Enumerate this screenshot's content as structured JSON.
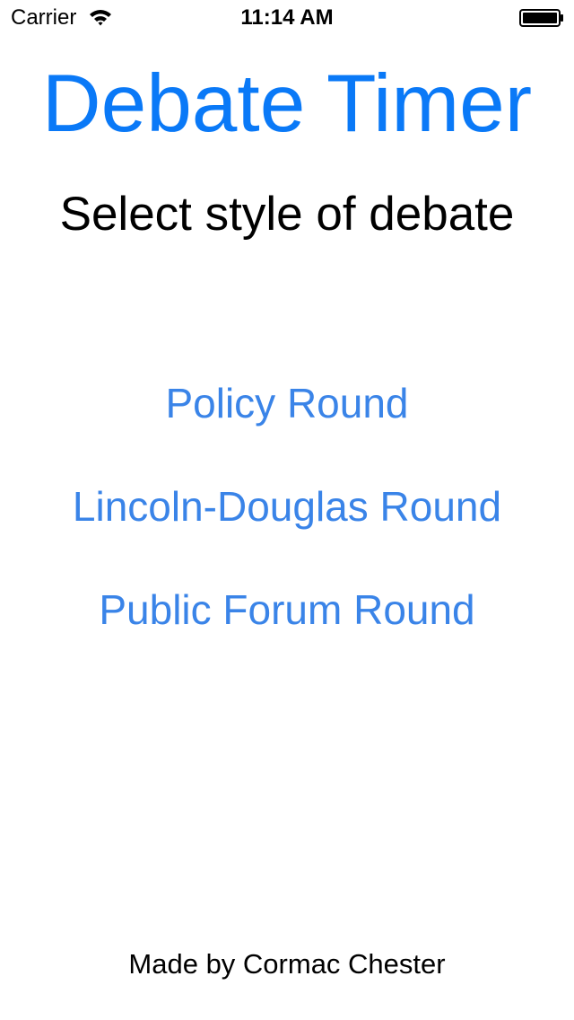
{
  "status_bar": {
    "carrier": "Carrier",
    "time": "11:14 AM",
    "wifi_icon": "wifi-icon",
    "battery_icon": "battery-icon",
    "battery_level": 1.0
  },
  "app": {
    "title": "Debate Timer",
    "subtitle": "Select style of debate",
    "accent_color": "#0a79f7",
    "button_color": "#3a84e8"
  },
  "rounds": [
    {
      "label": "Policy Round"
    },
    {
      "label": "Lincoln-Douglas Round"
    },
    {
      "label": "Public Forum Round"
    }
  ],
  "footer": {
    "credit": "Made by Cormac Chester"
  }
}
